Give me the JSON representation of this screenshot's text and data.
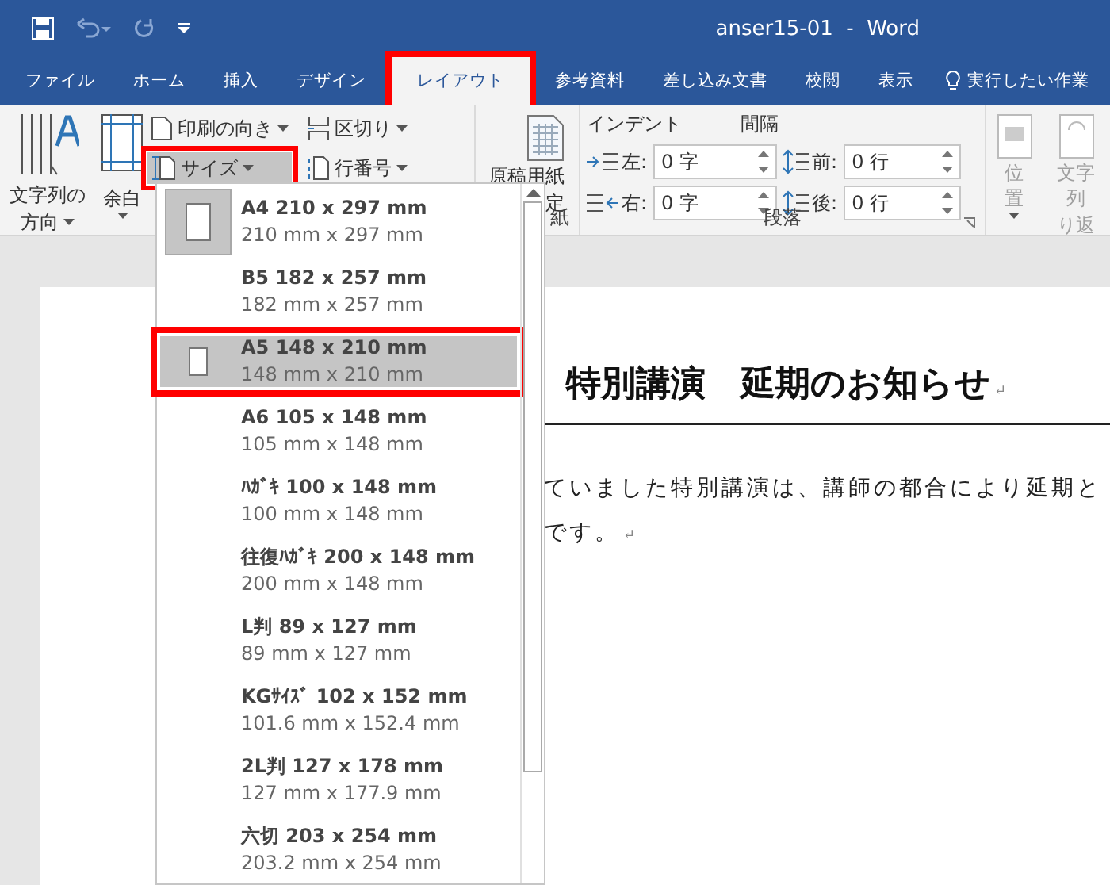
{
  "window": {
    "title": "anser15-01  -  Word"
  },
  "tabs": [
    {
      "label": "ファイル",
      "selected": false,
      "framed": false
    },
    {
      "label": "ホーム",
      "selected": false,
      "framed": false
    },
    {
      "label": "挿入",
      "selected": false,
      "framed": false
    },
    {
      "label": "デザイン",
      "selected": false,
      "framed": false
    },
    {
      "label": "レイアウト",
      "selected": true,
      "framed": true
    },
    {
      "label": "参考資料",
      "selected": false,
      "framed": false
    },
    {
      "label": "差し込み文書",
      "selected": false,
      "framed": false
    },
    {
      "label": "校閲",
      "selected": false,
      "framed": false
    },
    {
      "label": "表示",
      "selected": false,
      "framed": false
    }
  ],
  "tell_me": "実行したい作業",
  "ribbon": {
    "text_direction": [
      "文字列の",
      "方向"
    ],
    "margins": "余白",
    "orientation": "印刷の向き",
    "size": {
      "label": "サイズ",
      "framed": true,
      "pressed": true
    },
    "breaks": "区切り",
    "line_numbers": "行番号",
    "manuscript": [
      "原稿用紙",
      "定"
    ],
    "manuscript_group": "紙",
    "indent_heading": "インデント",
    "spacing_heading": "間隔",
    "fields": [
      {
        "label": "左:",
        "value": "0 字",
        "kind": "indent-left"
      },
      {
        "label": "前:",
        "value": "0 行",
        "kind": "space-before"
      },
      {
        "label": "右:",
        "value": "0 字",
        "kind": "indent-right"
      },
      {
        "label": "後:",
        "value": "0 行",
        "kind": "space-after"
      }
    ],
    "paragraph_group": "段落",
    "position": {
      "label": "位置",
      "disabled": true
    },
    "wrap": {
      "label": [
        "文字列",
        "り返"
      ],
      "disabled": true
    }
  },
  "size_menu": [
    {
      "name": "A4 210 x 297 mm",
      "detail": "210 mm x 297 mm",
      "page_icon": true,
      "current": true,
      "hovered": false,
      "framed": false
    },
    {
      "name": "B5 182 x 257 mm",
      "detail": "182 mm x 257 mm",
      "page_icon": false,
      "current": false,
      "hovered": false,
      "framed": false
    },
    {
      "name": "A5 148 x 210 mm",
      "detail": "148 mm x 210 mm",
      "page_icon": true,
      "current": false,
      "hovered": true,
      "framed": true
    },
    {
      "name": "A6 105 x 148 mm",
      "detail": "105 mm x 148 mm",
      "page_icon": false,
      "current": false,
      "hovered": false,
      "framed": false
    },
    {
      "name": "ﾊｶﾞｷ 100 x 148 mm",
      "detail": "100 mm x 148 mm",
      "page_icon": false,
      "current": false,
      "hovered": false,
      "framed": false
    },
    {
      "name": "往復ﾊｶﾞｷ 200 x 148 mm",
      "detail": "200 mm x 148 mm",
      "page_icon": false,
      "current": false,
      "hovered": false,
      "framed": false
    },
    {
      "name": "L判 89 x 127 mm",
      "detail": "89 mm x 127 mm",
      "page_icon": false,
      "current": false,
      "hovered": false,
      "framed": false
    },
    {
      "name": "KGｻｲｽﾞ 102 x 152 mm",
      "detail": "101.6 mm x 152.4 mm",
      "page_icon": false,
      "current": false,
      "hovered": false,
      "framed": false
    },
    {
      "name": "2L判 127 x 178 mm",
      "detail": "127 mm x 177.9 mm",
      "page_icon": false,
      "current": false,
      "hovered": false,
      "framed": false
    },
    {
      "name": "六切 203 x 254 mm",
      "detail": "203.2 mm x 254 mm",
      "page_icon": false,
      "current": false,
      "hovered": false,
      "framed": false
    }
  ],
  "document": {
    "heading": "特別講演　延期のお知らせ",
    "heading_mark": "↵",
    "body": [
      {
        "text": "ていました特別講演は、講師の都合により延期と"
      },
      {
        "text": "です。",
        "mark": "↵"
      }
    ]
  }
}
